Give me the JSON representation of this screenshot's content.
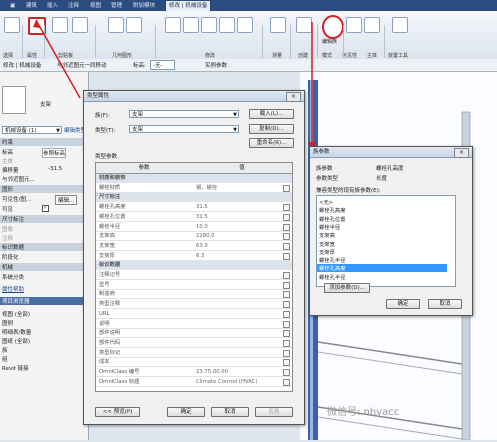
{
  "ribbon": {
    "tabs": [
      "建筑",
      "插入",
      "注释",
      "视图",
      "管理",
      "附加模块",
      "修改 | 机械设备"
    ],
    "groups": [
      "选择",
      "属性",
      "剪贴板",
      "几何图形",
      "修改",
      "测量",
      "创建",
      "模式",
      "可见性",
      "主体",
      "放置工具"
    ],
    "edit_family": "编辑族"
  },
  "options_bar": {
    "context": "修改 | 机械设备",
    "move_with": "与邻近图元一同移动",
    "level_label": "标高:",
    "level_value": "-无-",
    "solid_param": "实例参数"
  },
  "properties_panel": {
    "family_label": "支架",
    "selector": "机械设备 (1)",
    "edit_type": "编辑类型",
    "rows": [
      "约束",
      "标高",
      "主体",
      "偏移量",
      "与邻近图元...",
      "图形",
      "可见性/图...",
      "可见",
      "尺寸标注",
      "标识数据",
      "阶段化",
      "机械",
      "系统分类"
    ],
    "offset_value": "-31.5",
    "level_value": "参照标高",
    "help": "属性帮助",
    "browser_title": "项目浏览器",
    "tree": [
      "视图 (全部)",
      "图例",
      "明细表/数量",
      "图纸 (全部)",
      "族",
      "组",
      "Revit 链接"
    ]
  },
  "type_props_dialog": {
    "title": "类型属性",
    "family_label": "族(F):",
    "family_value": "支架",
    "load_button": "载入(L)...",
    "type_label": "类型(T):",
    "type_value": "支架",
    "duplicate_button": "复制(D)...",
    "rename_button": "重命名(R)...",
    "params_label": "类型参数",
    "col_param": "参数",
    "col_value": "值",
    "rows": [
      {
        "name": "材质和装饰",
        "value": "",
        "section": true
      },
      {
        "name": "螺栓材质",
        "value": "钢，螺栓",
        "section": false
      },
      {
        "name": "尺寸标注",
        "value": "",
        "section": true
      },
      {
        "name": "螺栓孔高度",
        "value": "31.5",
        "section": false
      },
      {
        "name": "螺栓孔位置",
        "value": "31.5",
        "section": false
      },
      {
        "name": "螺栓半径",
        "value": "10.0",
        "section": false
      },
      {
        "name": "支架高",
        "value": "2280.0",
        "section": false
      },
      {
        "name": "支架宽",
        "value": "63.0",
        "section": false
      },
      {
        "name": "支架厚",
        "value": "6.3",
        "section": false
      },
      {
        "name": "标识数据",
        "value": "",
        "section": true
      },
      {
        "name": "注释记号",
        "value": "",
        "section": false
      },
      {
        "name": "型号",
        "value": "",
        "section": false
      },
      {
        "name": "制造商",
        "value": "",
        "section": false
      },
      {
        "name": "类型注释",
        "value": "",
        "section": false
      },
      {
        "name": "URL",
        "value": "",
        "section": false
      },
      {
        "name": "说明",
        "value": "",
        "section": false
      },
      {
        "name": "部件说明",
        "value": "",
        "section": false
      },
      {
        "name": "部件代码",
        "value": "",
        "section": false
      },
      {
        "name": "类型标记",
        "value": "",
        "section": false
      },
      {
        "name": "成本",
        "value": "",
        "section": false
      },
      {
        "name": "OmniClass 编号",
        "value": "23.75.00.00",
        "section": false
      },
      {
        "name": "OmniClass 标题",
        "value": "Climate Control (HVAC)",
        "section": false
      }
    ],
    "preview_button": "<< 预览(P)",
    "ok_button": "确定",
    "cancel_button": "取消",
    "apply_button": "应用"
  },
  "family_params_dialog": {
    "title": "族参数",
    "param_label": "族参数",
    "param_value": "螺栓孔高度",
    "type_label": "参数类型",
    "type_value": "长度",
    "list_label": "兼容类型的现有族参数(E):",
    "items": [
      "<无>",
      "螺栓孔高度",
      "螺栓孔位置",
      "螺栓半径",
      "支架高",
      "支架宽",
      "支架厚",
      "螺栓孔半径",
      "螺栓孔高度",
      "螺栓孔半径"
    ],
    "selected_index": 8,
    "add_button": "添加参数(D)...",
    "ok_button": "确定",
    "cancel_button": "取消"
  },
  "watermark": "微信号: nhvacc",
  "colors": {
    "ribbon_dark": "#2b4c7e",
    "highlight": "#3399ff",
    "annotation": "#d42020",
    "steel": "#3a62a8"
  }
}
